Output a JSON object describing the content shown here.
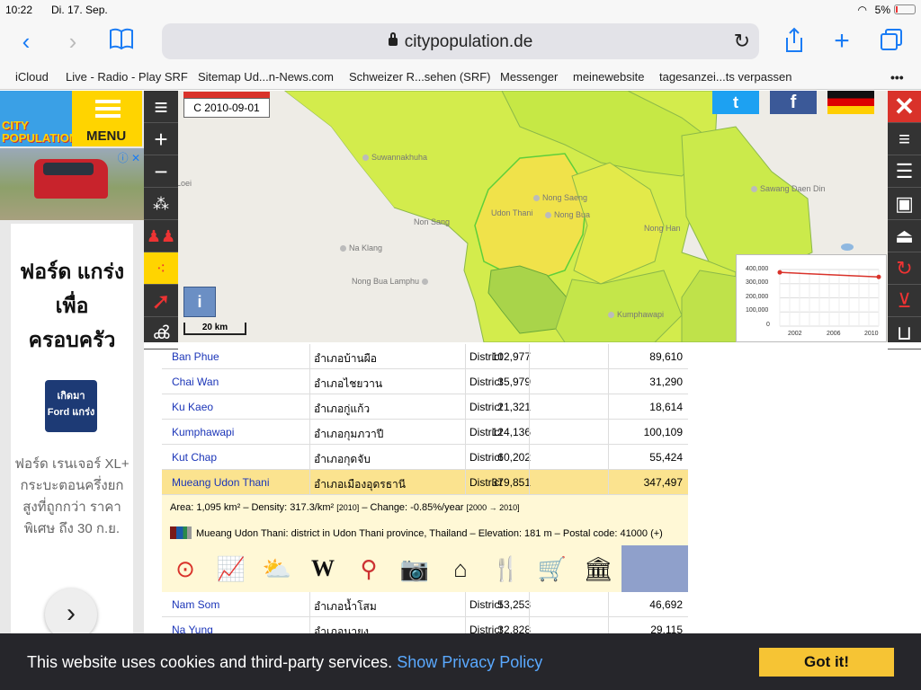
{
  "status": {
    "time": "10:22",
    "date": "Di. 17. Sep.",
    "battery": "5%"
  },
  "browser": {
    "url": "citypopulation.de",
    "bookmarks": [
      "iCloud",
      "Live - Radio - Play SRF",
      "Sitemap Ud...n-News.com",
      "Schweizer R...sehen (SRF)",
      "Messenger",
      "meinewebsite",
      "tagesanzei...ts verpassen"
    ],
    "more": "•••"
  },
  "ad": {
    "logo": "CITY POPULATION",
    "menu_label": "MENU",
    "headline": "ฟอร์ด แกร่งเพื่อ ครอบครัว",
    "badge": "เกิดมา Ford แกร่ง",
    "description": "ฟอร์ด เรนเจอร์ XL+ กระบะตอนครึ่งยกสูงที่ถูกกว่า ราคาพิเศษ ถึง 30 ก.ย."
  },
  "map": {
    "date": "C 2010-09-01",
    "places": [
      "Suwannakhuha",
      "Loei",
      "Nong Saeng",
      "Udon Thani",
      "Nong Bua",
      "Non Sang",
      "Na Klang",
      "Nong Bua Lamphu",
      "Sawang Daen Din",
      "Nong Han",
      "Kumphawapi"
    ],
    "info_label": "i",
    "scale_label": "20 km"
  },
  "chart_data": {
    "type": "line",
    "x": [
      2000,
      2010
    ],
    "series": [
      {
        "values": [
          379851,
          347497
        ]
      }
    ],
    "ylim": [
      0,
      400000
    ],
    "yticks": [
      "400,000",
      "300,000",
      "200,000",
      "100,000",
      "0"
    ],
    "xticks": [
      "2002",
      "2006",
      "2010"
    ]
  },
  "table": {
    "rows_before": [
      {
        "name": "Ban Phue",
        "native": "อำเภอบ้านผือ",
        "status": "District",
        "pop2000": "102,977",
        "pop2010": "89,610"
      },
      {
        "name": "Chai Wan",
        "native": "อำเภอไชยวาน",
        "status": "District",
        "pop2000": "35,979",
        "pop2010": "31,290"
      },
      {
        "name": "Ku Kaeo",
        "native": "อำเภอกู่แก้ว",
        "status": "District",
        "pop2000": "21,321",
        "pop2010": "18,614"
      },
      {
        "name": "Kumphawapi",
        "native": "อำเภอกุมภวาปี",
        "status": "District",
        "pop2000": "124,136",
        "pop2010": "100,109"
      },
      {
        "name": "Kut Chap",
        "native": "อำเภอกุดจับ",
        "status": "District",
        "pop2000": "60,202",
        "pop2010": "55,424"
      }
    ],
    "selected": {
      "name": "Mueang Udon Thani",
      "native": "อำเภอเมืองอุดรธานี",
      "status": "District",
      "pop2000": "379,851",
      "pop2010": "347,497"
    },
    "details": {
      "area_line": "Area: 1,095 km² – Density: 317.3/km²",
      "density_year": "[2010]",
      "change": "– Change: -0.85%/year",
      "change_years": "[2000 → 2010]",
      "description": "Mueang Udon Thani: district in Udon Thani province, Thailand – Elevation: 181 m – Postal code: 41000 (+)"
    },
    "rows_after": [
      {
        "name": "Nam Som",
        "native": "อำเภอน้ำโสม",
        "status": "District",
        "pop2000": "53,253",
        "pop2010": "46,692"
      },
      {
        "name": "Na Yung",
        "native": "อำเภอนายูง",
        "status": "District",
        "pop2000": "32,828",
        "pop2010": "29,115"
      }
    ]
  },
  "cookie": {
    "message": "This website uses cookies and third-party services.",
    "link": "Show Privacy Policy",
    "button": "Got it!"
  },
  "colors": {
    "accent_yellow": "#f6c434",
    "map_highlight": "#f2e24a",
    "map_green": "#c8ea48",
    "close_red": "#d9322a"
  }
}
